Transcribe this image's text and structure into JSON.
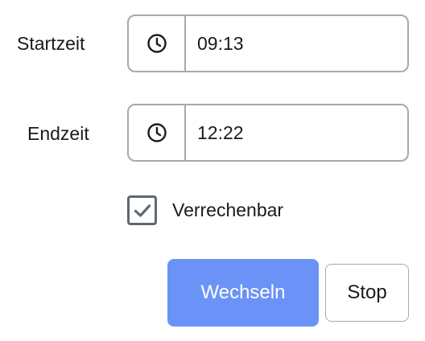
{
  "start": {
    "label": "Startzeit",
    "icon": "clock-icon",
    "value": "09:13"
  },
  "end": {
    "label": "Endzeit",
    "icon": "clock-icon",
    "value": "12:22"
  },
  "billable": {
    "label": "Verrechenbar",
    "checked": true
  },
  "actions": {
    "switch_label": "Wechseln",
    "stop_label": "Stop"
  },
  "colors": {
    "primary": "#6b93f7",
    "border": "#a9a9a9",
    "checkbox": "#5a6a76"
  }
}
